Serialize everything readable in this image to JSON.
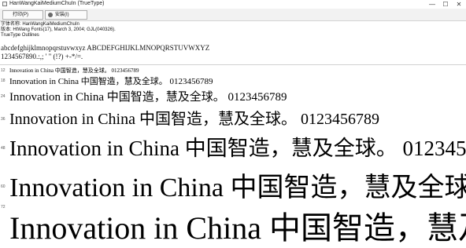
{
  "window": {
    "title": "HanWangKaiMediumChuIn (TrueType)",
    "controls": [
      "—",
      "☐",
      "✕"
    ]
  },
  "toolbar": {
    "print_label": "打印(P)",
    "install_label": "安装(I)"
  },
  "info": {
    "lines": [
      "字体名称: HanWangKaiMediumChuIn",
      "版本: HtWang Fonts(17), March 3, 2004; GJL(040326).",
      "TrueType Outlines"
    ]
  },
  "charset": {
    "lines": [
      "abcdefghijklmnopqrstuvwxyz  ABCDEFGHIJKLMNOPQRSTUVWXYZ",
      "1234567890.:,; ' \" (!?) +-*/=."
    ]
  },
  "sample": {
    "text": "Innovation in China 中国智造，慧及全球。 0123456789",
    "sizes": [
      "12",
      "18",
      "24",
      "36",
      "48",
      "60",
      "72"
    ]
  }
}
